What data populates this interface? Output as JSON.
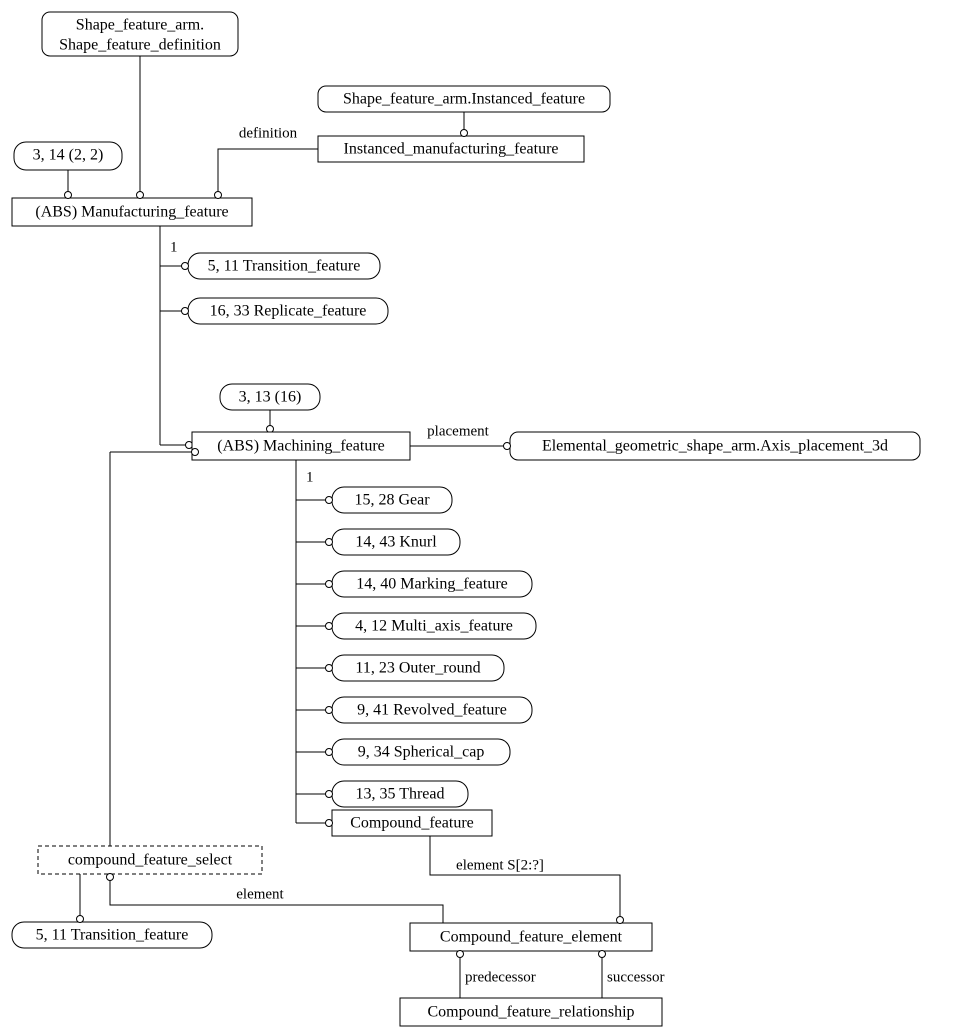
{
  "nodes": {
    "shape_feature_def_1": "Shape_feature_arm.",
    "shape_feature_def_2": "Shape_feature_definition",
    "instanced_feature_ref": "Shape_feature_arm.Instanced_feature",
    "instanced_mfg_feature": "Instanced_manufacturing_feature",
    "pill_3_14": "3, 14 (2, 2)",
    "abs_mfg_feature": "(ABS) Manufacturing_feature",
    "pill_transition_1": "5, 11 Transition_feature",
    "pill_replicate": "16, 33 Replicate_feature",
    "pill_3_13": "3, 13 (16)",
    "abs_machining": "(ABS) Machining_feature",
    "axis_placement": "Elemental_geometric_shape_arm.Axis_placement_3d",
    "pill_gear": "15, 28 Gear",
    "pill_knurl": "14, 43 Knurl",
    "pill_marking": "14, 40 Marking_feature",
    "pill_multi_axis": "4, 12 Multi_axis_feature",
    "pill_outer_round": "11, 23 Outer_round",
    "pill_revolved": "9, 41 Revolved_feature",
    "pill_spherical": "9, 34 Spherical_cap",
    "pill_thread": "13, 35 Thread",
    "compound_feature": "Compound_feature",
    "compound_feature_select": "compound_feature_select",
    "pill_transition_2": "5, 11 Transition_feature",
    "compound_feature_element": "Compound_feature_element",
    "compound_feature_rel": "Compound_feature_relationship"
  },
  "edges": {
    "definition": "definition",
    "placement": "placement",
    "one_a": "1",
    "one_b": "1",
    "element_set": "element S[2:?]",
    "element": "element",
    "predecessor": "predecessor",
    "successor": "successor"
  }
}
